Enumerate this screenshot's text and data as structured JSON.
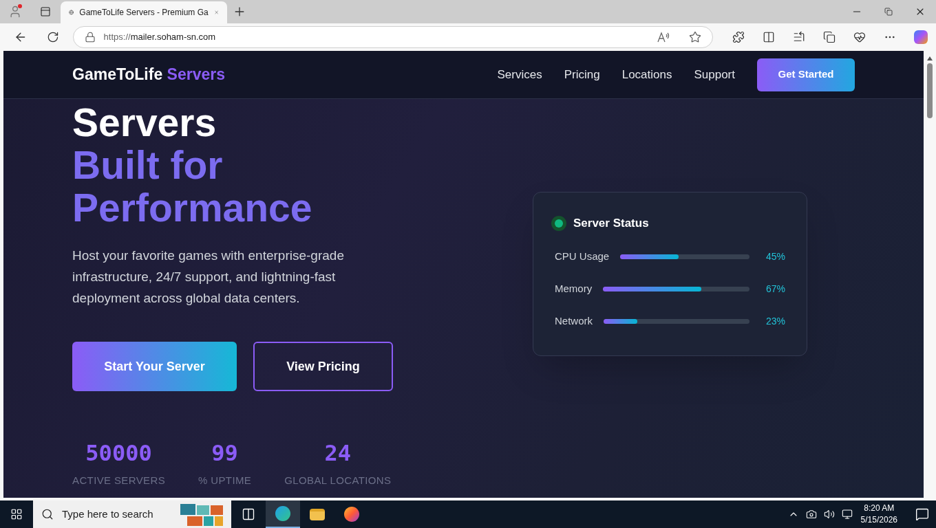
{
  "browser": {
    "tab_title": "GameToLife Servers - Premium Ga",
    "url_scheme": "https://",
    "url_host": "mailer.soham-sn.com"
  },
  "header": {
    "brand": "GameToLife",
    "brand_accent": "Servers",
    "nav": [
      {
        "label": "Services"
      },
      {
        "label": "Pricing"
      },
      {
        "label": "Locations"
      },
      {
        "label": "Support"
      }
    ],
    "cta": "Get Started"
  },
  "hero": {
    "lines": [
      {
        "text": "Servers",
        "accent": false
      },
      {
        "text": "Built for",
        "accent": true
      },
      {
        "text": "Performance",
        "accent": true
      }
    ],
    "description": "Host your favorite games with enterprise-grade infrastructure, 24/7 support, and lightning-fast deployment across global data centers.",
    "buttons": [
      {
        "label": "Start Your Server",
        "kind": "primary"
      },
      {
        "label": "View Pricing",
        "kind": "outline"
      }
    ],
    "stats": [
      {
        "value": "50000",
        "label": "ACTIVE SERVERS"
      },
      {
        "value": "99",
        "label": "% UPTIME"
      },
      {
        "value": "24",
        "label": "GLOBAL LOCATIONS"
      }
    ]
  },
  "status_card": {
    "title": "Server Status",
    "metrics": [
      {
        "label": "CPU Usage",
        "level": 0.45,
        "reading": "45%"
      },
      {
        "label": "Memory",
        "level": 0.67,
        "reading": "67%"
      },
      {
        "label": "Network",
        "level": 0.23,
        "reading": "23%"
      }
    ]
  },
  "taskbar": {
    "search_placeholder": "Type here to search",
    "time": "8:20 AM",
    "date": "5/15/2026"
  }
}
